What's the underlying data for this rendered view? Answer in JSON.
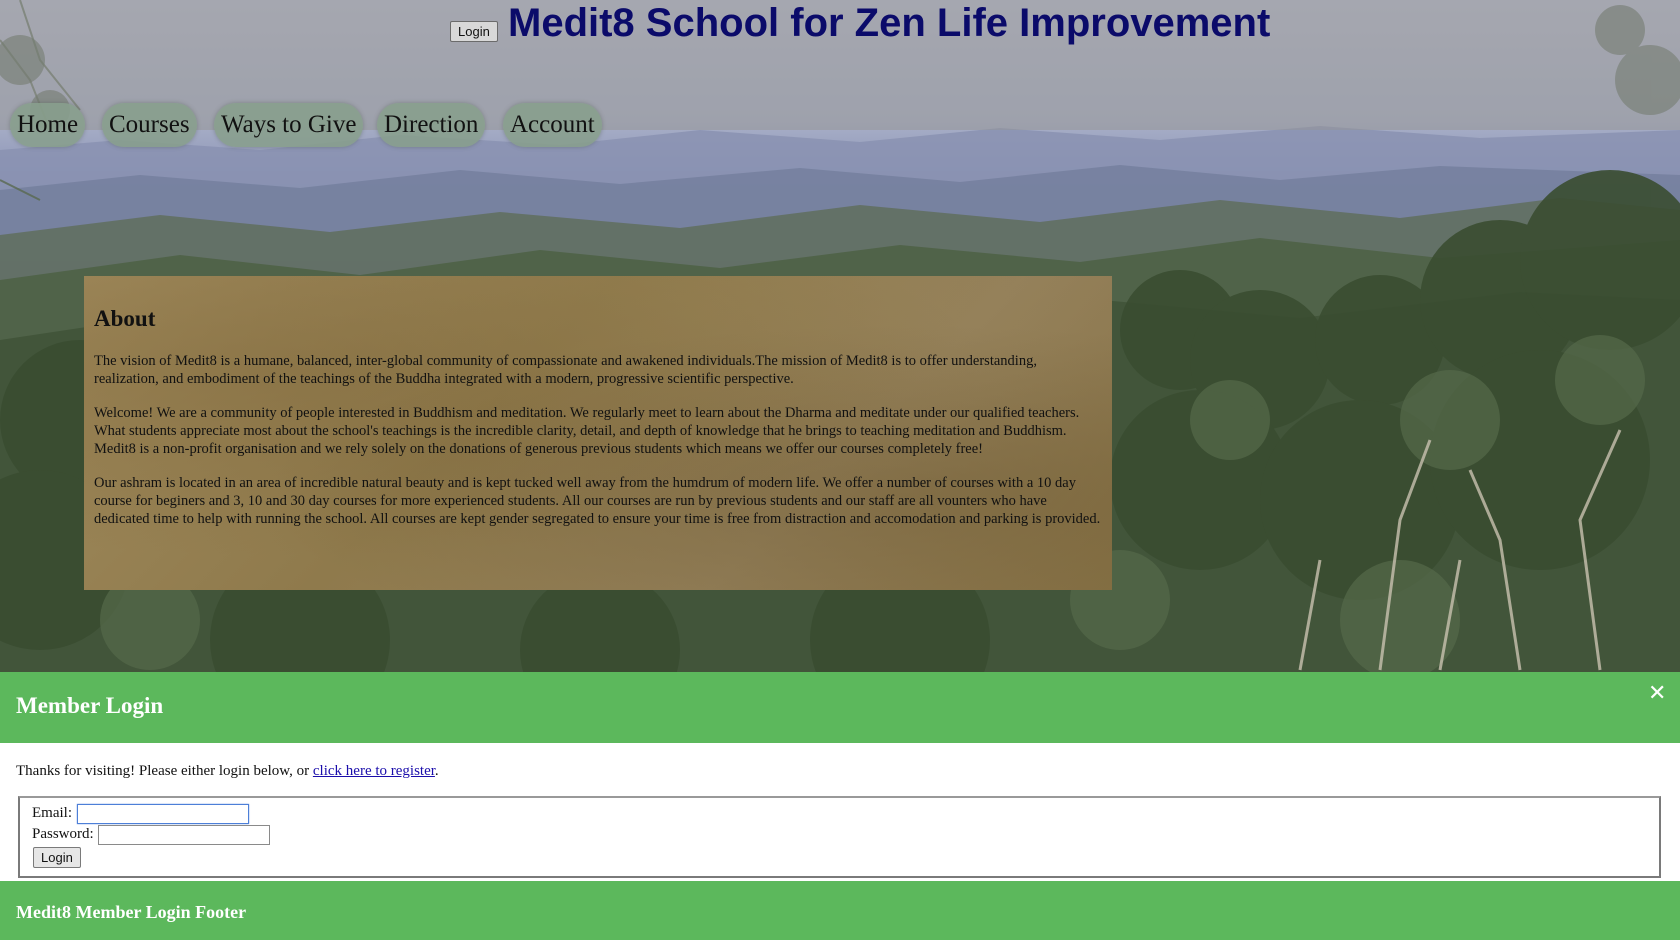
{
  "header": {
    "title": "Medit8 School for Zen Life Improvement",
    "login_button": "Login"
  },
  "nav": {
    "items": [
      {
        "label": "Home"
      },
      {
        "label": "Courses"
      },
      {
        "label": "Ways to Give"
      },
      {
        "label": "Direction"
      },
      {
        "label": "Account"
      }
    ]
  },
  "about": {
    "heading": "About",
    "paragraphs": [
      "The vision of Medit8 is a humane, balanced, inter-global community of compassionate and awakened individuals.The mission of Medit8 is to offer understanding, realization, and embodiment of the teachings of the Buddha integrated with a modern, progressive scientific perspective.",
      "Welcome! We are a community of people interested in Buddhism and meditation. We regularly meet to learn about the Dharma and meditate under our qualified teachers. What students appreciate most about the school's teachings is the incredible clarity, detail, and depth of knowledge that he brings to teaching meditation and Buddhism. Medit8 is a non-profit organisation and we rely solely on the donations of generous previous students which means we offer our courses completely free!",
      "Our ashram is located in an area of incredible natural beauty and is kept tucked well away from the humdrum of modern life. We offer a number of courses with a 10 day course for beginers and 3, 10 and 30 day courses for more experienced students. All our courses are run by previous students and our staff are all vounters who have dedicated time to help with running the school. All courses are kept gender segregated to ensure your time is free from distraction and accomodation and parking is provided."
    ]
  },
  "modal": {
    "title": "Member Login",
    "close_glyph": "✕",
    "intro_text": "Thanks for visiting! Please either login below, or ",
    "register_link": "click here to register",
    "intro_end": ".",
    "email_label": "Email:",
    "email_value": "",
    "password_label": "Password:",
    "password_value": "",
    "login_button": "Login",
    "footer": "Medit8 Member Login Footer"
  },
  "colors": {
    "title": "#0b0b6a",
    "modal_green": "#5cb85c",
    "nav_pill": "#879e8c",
    "link": "#1a0dab"
  },
  "icons": {
    "close": "close-icon"
  }
}
